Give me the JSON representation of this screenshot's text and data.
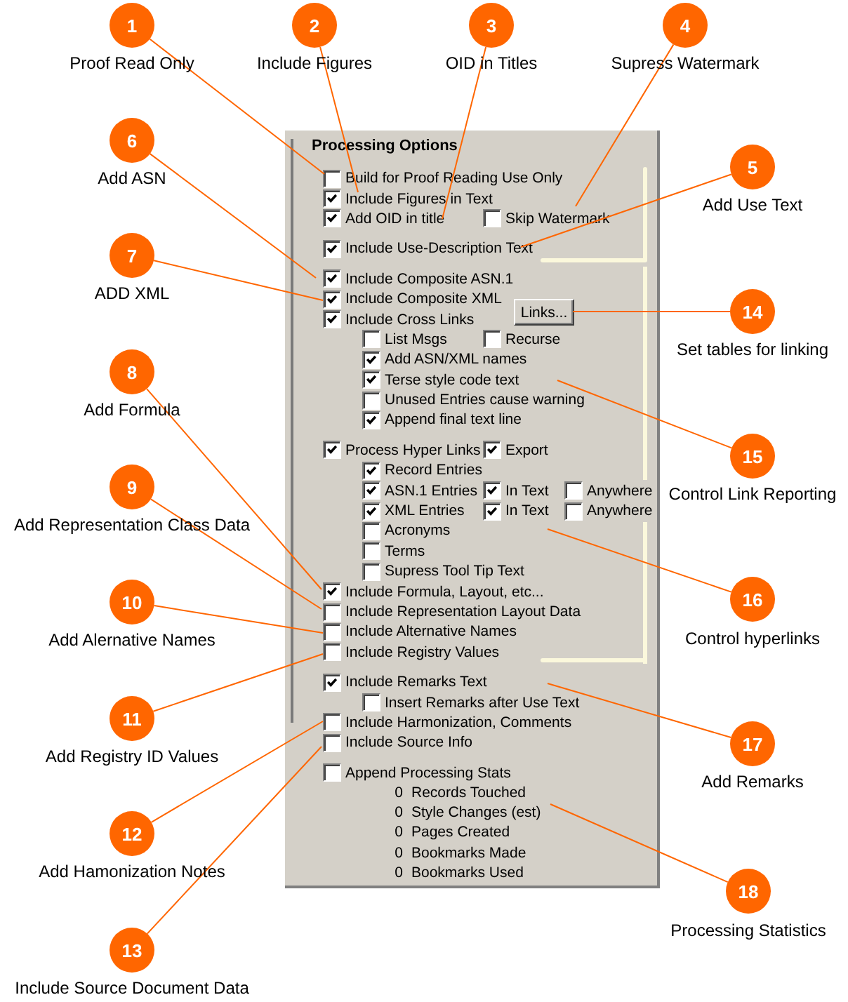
{
  "callouts": [
    {
      "number": "1",
      "label": "Proof Read Only"
    },
    {
      "number": "2",
      "label": "Include Figures"
    },
    {
      "number": "3",
      "label": "OID in Titles"
    },
    {
      "number": "4",
      "label": "Supress Watermark"
    },
    {
      "number": "5",
      "label": "Add Use Text"
    },
    {
      "number": "6",
      "label": "Add ASN"
    },
    {
      "number": "7",
      "label": "ADD XML"
    },
    {
      "number": "8",
      "label": "Add Formula"
    },
    {
      "number": "9",
      "label": "Add Representation Class Data"
    },
    {
      "number": "10",
      "label": "Add Alernative Names"
    },
    {
      "number": "11",
      "label": "Add Registry ID Values"
    },
    {
      "number": "12",
      "label": "Add Hamonization Notes"
    },
    {
      "number": "13",
      "label": "Include Source Document Data"
    },
    {
      "number": "14",
      "label": "Set tables for linking"
    },
    {
      "number": "15",
      "label": "Control Link Reporting"
    },
    {
      "number": "16",
      "label": "Control hyperlinks"
    },
    {
      "number": "17",
      "label": "Add Remarks"
    },
    {
      "number": "18",
      "label": "Processing Statistics"
    }
  ],
  "panel": {
    "title": "Processing Options",
    "groups": [
      [
        {
          "label": "Build for Proof Reading Use Only",
          "checked": false
        },
        {
          "label": "Include Figures in Text",
          "checked": true
        },
        {
          "label": "Add OID in title",
          "checked": true,
          "extras": [
            {
              "label": "Skip Watermark",
              "checked": false
            }
          ]
        }
      ],
      [
        {
          "label": "Include Use-Description Text",
          "checked": true
        }
      ],
      [
        {
          "label": "Include Composite ASN.1",
          "checked": true
        },
        {
          "label": "Include Composite XML",
          "checked": true
        },
        {
          "label": "Include Cross Links",
          "checked": true,
          "button": "Links...",
          "children": [
            {
              "label": "List Msgs",
              "checked": false,
              "extras": [
                {
                  "label": "Recurse",
                  "checked": false
                }
              ]
            },
            {
              "label": "Add ASN/XML names",
              "checked": true
            },
            {
              "label": "Terse style code text",
              "checked": true
            },
            {
              "label": "Unused Entries cause warning",
              "checked": false
            },
            {
              "label": "Append final text line",
              "checked": true
            }
          ]
        }
      ],
      [
        {
          "label": "Process Hyper Links",
          "checked": true,
          "extras": [
            {
              "label": "Export",
              "checked": true
            }
          ],
          "children": [
            {
              "label": "Record Entries",
              "checked": true
            },
            {
              "label": "ASN.1 Entries",
              "checked": true,
              "extras": [
                {
                  "label": "In Text",
                  "checked": true
                },
                {
                  "label": "Anywhere",
                  "checked": false
                }
              ]
            },
            {
              "label": "XML Entries",
              "checked": true,
              "extras": [
                {
                  "label": "In Text",
                  "checked": true
                },
                {
                  "label": "Anywhere",
                  "checked": false
                }
              ]
            },
            {
              "label": "Acronyms",
              "checked": false
            },
            {
              "label": "Terms",
              "checked": false
            },
            {
              "label": "Supress Tool Tip Text",
              "checked": false
            }
          ]
        },
        {
          "label": "Include Formula, Layout, etc...",
          "checked": true
        },
        {
          "label": "Include Representation Layout Data",
          "checked": false
        },
        {
          "label": "Include Alternative Names",
          "checked": false
        },
        {
          "label": "Include Registry Values",
          "checked": false
        }
      ],
      [
        {
          "label": "Include Remarks Text",
          "checked": true,
          "children": [
            {
              "label": "Insert Remarks after Use Text",
              "checked": false
            }
          ]
        },
        {
          "label": "Include Harmonization, Comments",
          "checked": false
        },
        {
          "label": "Include Source Info",
          "checked": false
        }
      ],
      [
        {
          "label": "Append Processing Stats",
          "checked": false,
          "stats": [
            {
              "count": "0",
              "text": "Records Touched"
            },
            {
              "count": "0",
              "text": "Style Changes (est)"
            },
            {
              "count": "0",
              "text": "Pages Created"
            },
            {
              "count": "0",
              "text": "Bookmarks Made"
            },
            {
              "count": "0",
              "text": "Bookmarks Used"
            }
          ]
        }
      ]
    ]
  }
}
